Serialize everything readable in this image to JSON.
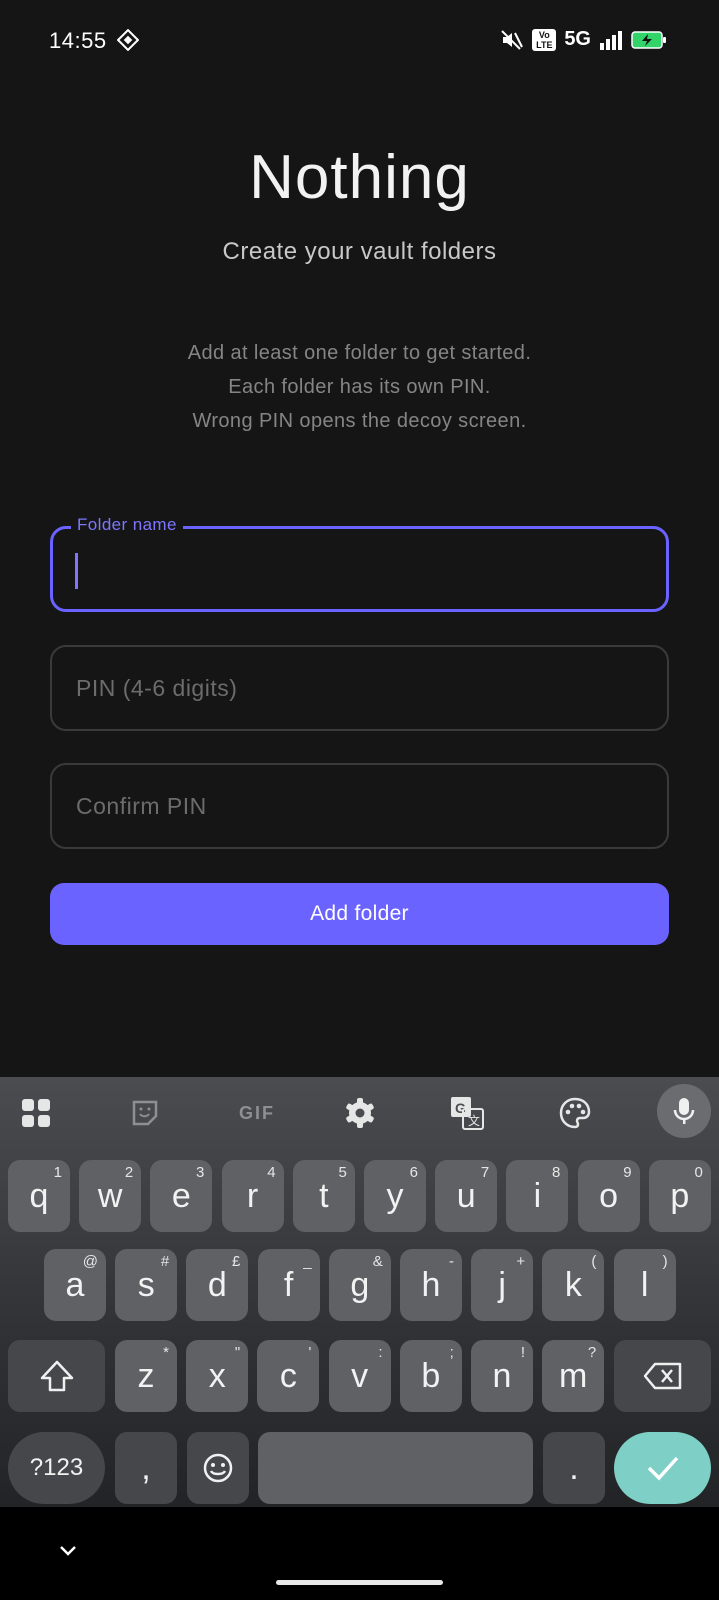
{
  "status_bar": {
    "time": "14:55",
    "network": "5G",
    "volte_label": "Vo\nLTE",
    "icons": [
      "diamond-app-icon",
      "mute-icon",
      "volte-icon",
      "signal-icon",
      "battery-charging-icon"
    ]
  },
  "header": {
    "title": "Nothing",
    "subtitle": "Create your vault folders"
  },
  "info": {
    "line1": "Add at least one folder to get started.",
    "line2": "Each folder has its own PIN.",
    "line3": "Wrong PIN opens the decoy screen."
  },
  "form": {
    "folder_name_label": "Folder name",
    "folder_name_value": "",
    "pin_placeholder": "PIN (4-6 digits)",
    "confirm_pin_placeholder": "Confirm PIN",
    "add_button": "Add folder"
  },
  "keyboard": {
    "toolbar": [
      "apps-grid-icon",
      "sticker-icon",
      "gif-icon",
      "settings-gear-icon",
      "translate-icon",
      "palette-icon",
      "microphone-icon"
    ],
    "gif_label": "GIF",
    "row1": [
      {
        "k": "q",
        "h": "1"
      },
      {
        "k": "w",
        "h": "2"
      },
      {
        "k": "e",
        "h": "3"
      },
      {
        "k": "r",
        "h": "4"
      },
      {
        "k": "t",
        "h": "5"
      },
      {
        "k": "y",
        "h": "6"
      },
      {
        "k": "u",
        "h": "7"
      },
      {
        "k": "i",
        "h": "8"
      },
      {
        "k": "o",
        "h": "9"
      },
      {
        "k": "p",
        "h": "0"
      }
    ],
    "row2": [
      {
        "k": "a",
        "h": "@"
      },
      {
        "k": "s",
        "h": "#"
      },
      {
        "k": "d",
        "h": "£"
      },
      {
        "k": "f",
        "h": "_"
      },
      {
        "k": "g",
        "h": "&"
      },
      {
        "k": "h",
        "h": "-"
      },
      {
        "k": "j",
        "h": "+"
      },
      {
        "k": "k",
        "h": "("
      },
      {
        "k": "l",
        "h": ")"
      }
    ],
    "row3": [
      {
        "k": "z",
        "h": "*"
      },
      {
        "k": "x",
        "h": "\""
      },
      {
        "k": "c",
        "h": "'"
      },
      {
        "k": "v",
        "h": ":"
      },
      {
        "k": "b",
        "h": ";"
      },
      {
        "k": "n",
        "h": "!"
      },
      {
        "k": "m",
        "h": "?"
      }
    ],
    "symbols_label": "?123",
    "comma": ",",
    "period": "."
  },
  "colors": {
    "accent": "#6b63ff",
    "background": "#151515",
    "enter_key": "#7ed0c6"
  }
}
